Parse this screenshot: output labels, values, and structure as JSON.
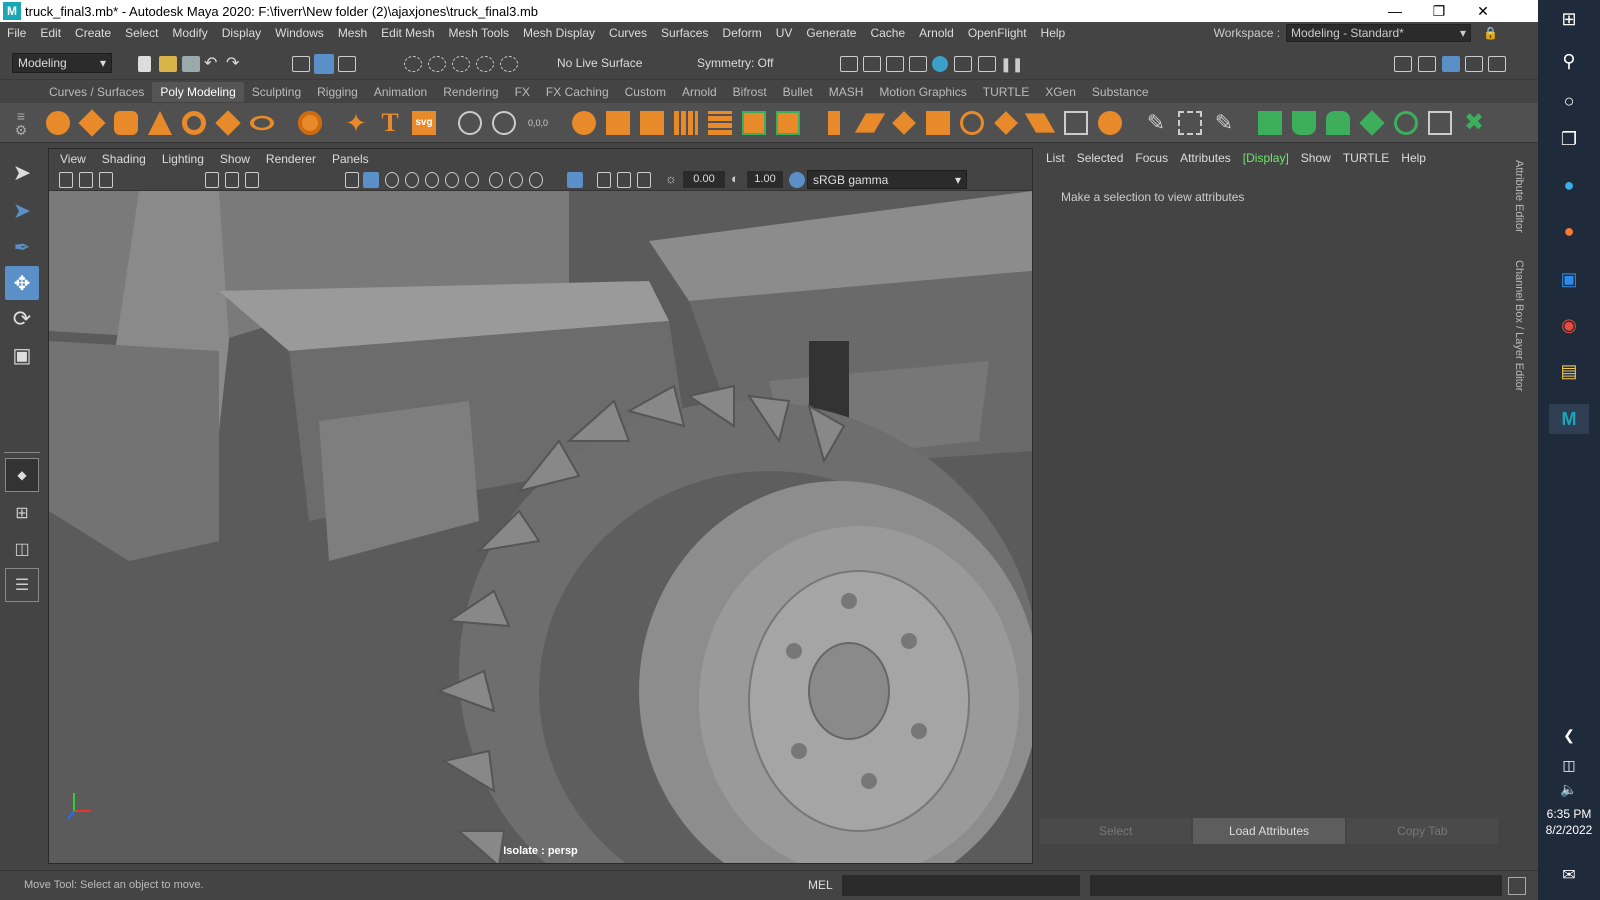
{
  "title_bar": {
    "text": "truck_final3.mb* - Autodesk Maya 2020: F:\\fiverr\\New folder (2)\\ajaxjones\\truck_final3.mb",
    "logo": "M"
  },
  "menus": [
    "File",
    "Edit",
    "Create",
    "Select",
    "Modify",
    "Display",
    "Windows",
    "Mesh",
    "Edit Mesh",
    "Mesh Tools",
    "Mesh Display",
    "Curves",
    "Surfaces",
    "Deform",
    "UV",
    "Generate",
    "Cache",
    "Arnold",
    "OpenFlight",
    "Help"
  ],
  "workspace": {
    "label": "Workspace :",
    "value": "Modeling - Standard*"
  },
  "status_line": {
    "mode": "Modeling",
    "live_surface": "No Live Surface",
    "symmetry": "Symmetry: Off"
  },
  "shelf_tabs": [
    "Curves / Surfaces",
    "Poly Modeling",
    "Sculpting",
    "Rigging",
    "Animation",
    "Rendering",
    "FX",
    "FX Caching",
    "Custom",
    "Arnold",
    "Bifrost",
    "Bullet",
    "MASH",
    "Motion Graphics",
    "TURTLE",
    "XGen",
    "Substance"
  ],
  "active_shelf_tab": "Poly Modeling",
  "viewport": {
    "menu": [
      "View",
      "Shading",
      "Lighting",
      "Show",
      "Renderer",
      "Panels"
    ],
    "exposure": "0.00",
    "gamma": "1.00",
    "color_space": "sRGB gamma",
    "camera_label": "Isolate : persp"
  },
  "attribute_editor": {
    "menu": [
      "List",
      "Selected",
      "Focus",
      "Attributes",
      "[Display]",
      "Show",
      "TURTLE",
      "Help"
    ],
    "hint": "Make a selection to view attributes",
    "buttons": [
      "Select",
      "Load Attributes",
      "Copy Tab"
    ],
    "side_tabs": [
      "Attribute Editor",
      "Channel Box / Layer Editor"
    ]
  },
  "help_line": {
    "text": "Move Tool: Select an object to move.",
    "command_lang": "MEL"
  },
  "taskbar": {
    "time": "6:35 PM",
    "date": "8/2/2022"
  },
  "colors": {
    "accent_orange": "#e88a2a",
    "accent_green": "#3dae5c",
    "highlight_blue": "#5a8fc7",
    "display_green": "#6ee66e"
  }
}
